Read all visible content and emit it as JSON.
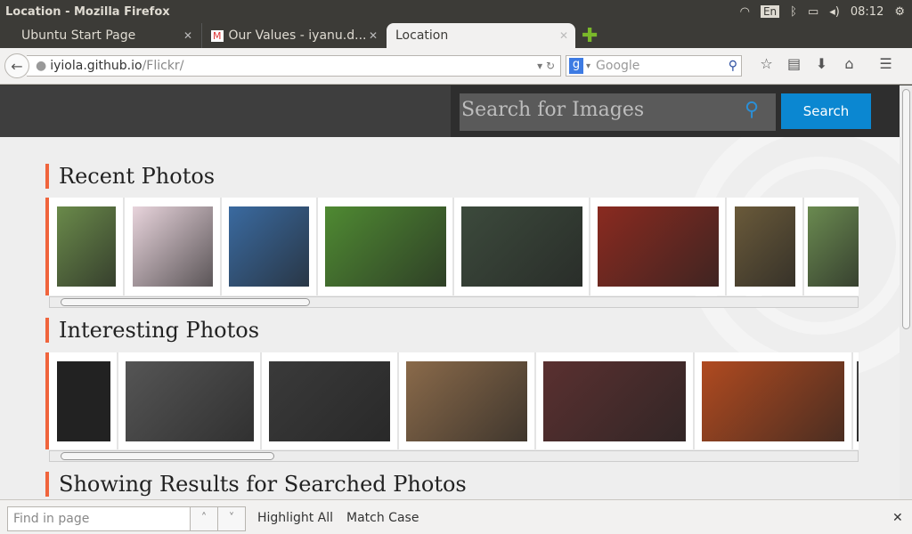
{
  "window": {
    "title": "Location - Mozilla Firefox",
    "tray": {
      "lang": "En",
      "time": "08:12"
    }
  },
  "tabs": [
    {
      "label": "Ubuntu Start Page"
    },
    {
      "label": "Our Values - iyanu.d..."
    },
    {
      "label": "Location",
      "active": true
    }
  ],
  "navbar": {
    "url_host": "iyiola.github.io",
    "url_path": "/Flickr/",
    "search_placeholder": "Google"
  },
  "page": {
    "search_placeholder": "Search for Images",
    "search_button": "Search",
    "sections": [
      {
        "title": "Recent Photos"
      },
      {
        "title": "Interesting Photos"
      },
      {
        "title": "Showing Results for Searched Photos"
      }
    ],
    "recent_photos": [
      "#6a8a4a",
      "#e8d4dc",
      "#3a6aa0",
      "#4f8a32",
      "#3c4a3c",
      "#8a2a20",
      "#6a5a3a",
      "#6a8a50"
    ],
    "interesting_photos": [
      "#222222",
      "#555555",
      "#3a3a3a",
      "#8a6a4a",
      "#5a3030",
      "#b04a20",
      "#444444"
    ]
  },
  "findbar": {
    "placeholder": "Find in page",
    "highlight_all": "Highlight All",
    "match_case": "Match Case"
  }
}
